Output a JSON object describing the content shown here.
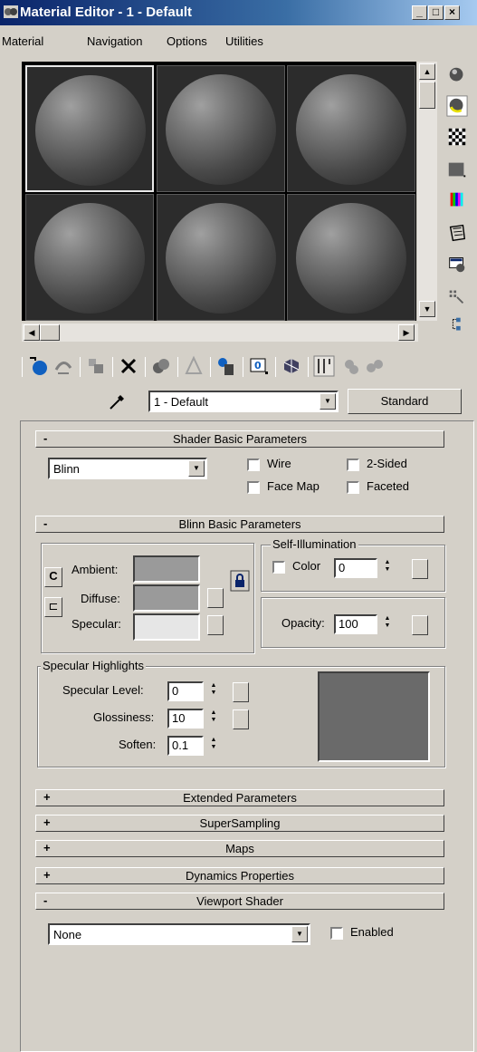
{
  "window": {
    "title": "Material Editor - 1 - Default"
  },
  "menu": [
    "Material",
    "Navigation",
    "Options",
    "Utilities"
  ],
  "material": {
    "name": "1 - Default",
    "type": "Standard"
  },
  "shader_basic": {
    "header": "Shader Basic Parameters",
    "shader": "Blinn",
    "wire": "Wire",
    "two_sided": "2-Sided",
    "face_map": "Face Map",
    "faceted": "Faceted"
  },
  "blinn_basic": {
    "header": "Blinn Basic Parameters",
    "ambient": "Ambient:",
    "diffuse": "Diffuse:",
    "specular": "Specular:",
    "self_illum": "Self-Illumination",
    "color": "Color",
    "color_value": "0",
    "opacity_label": "Opacity:",
    "opacity_value": "100",
    "spec_highlights": "Specular Highlights",
    "spec_level_label": "Specular Level:",
    "spec_level": "0",
    "glossiness_label": "Glossiness:",
    "glossiness": "10",
    "soften_label": "Soften:",
    "soften": "0.1",
    "colors": {
      "ambient": "#9a9a9a",
      "diffuse": "#9a9a9a",
      "specular": "#e6e6e6"
    }
  },
  "rollouts": [
    {
      "sign": "+",
      "label": "Extended Parameters"
    },
    {
      "sign": "+",
      "label": "SuperSampling"
    },
    {
      "sign": "+",
      "label": "Maps"
    },
    {
      "sign": "+",
      "label": "Dynamics Properties"
    }
  ],
  "viewport_shader": {
    "header": "Viewport Shader",
    "value": "None",
    "enabled": "Enabled"
  },
  "signs": {
    "collapse": "-"
  }
}
